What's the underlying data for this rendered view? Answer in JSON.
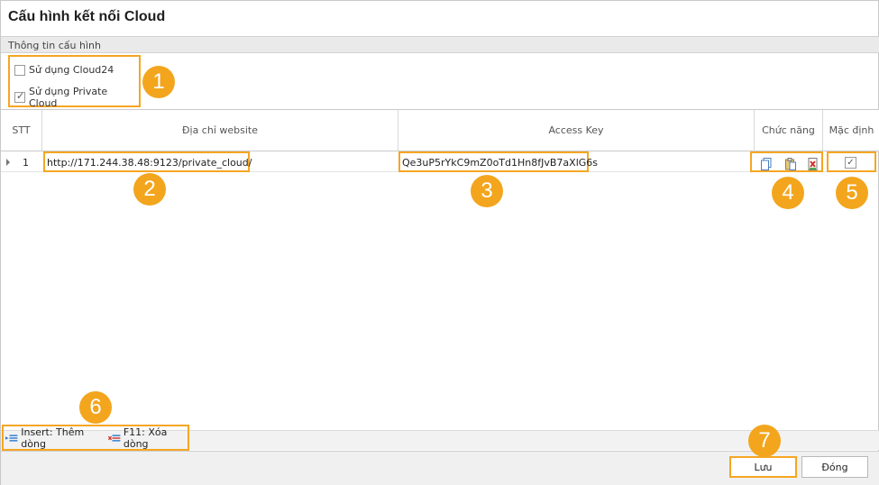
{
  "window": {
    "title": "Cấu hình kết nối Cloud"
  },
  "section": {
    "label": "Thông tin cấu hình"
  },
  "options": [
    {
      "label": "Sử dụng Cloud24",
      "checked": false
    },
    {
      "label": "Sử dụng Private Cloud",
      "checked": true
    }
  ],
  "grid": {
    "columns": [
      "STT",
      "Địa chỉ website",
      "Access Key",
      "Chức năng",
      "Mặc định"
    ],
    "rows": [
      {
        "stt": "1",
        "website": "http://171.244.38.48:9123/private_cloud/",
        "access_key": "Qe3uP5rYkC9mZ0oTd1Hn8fJvB7aXlG6s",
        "default": true
      }
    ],
    "function_icons": [
      "copy-icon",
      "paste-icon",
      "delete-icon"
    ]
  },
  "tools": {
    "insert_label": "Insert: Thêm dòng",
    "delete_label": "F11: Xóa dòng"
  },
  "buttons": {
    "save": "Lưu",
    "close": "Đóng"
  },
  "callouts": [
    "1",
    "2",
    "3",
    "4",
    "5",
    "6",
    "7"
  ],
  "colors": {
    "highlight": "#f5a623",
    "badge": "#f3a51d"
  }
}
